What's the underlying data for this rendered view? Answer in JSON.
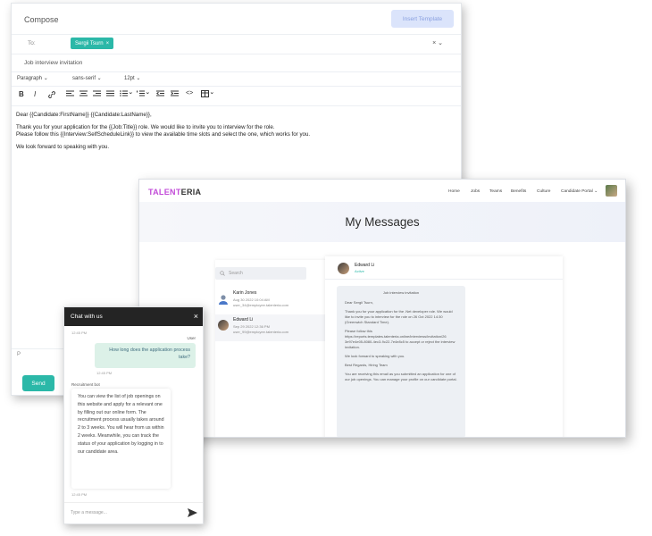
{
  "compose": {
    "title": "Compose",
    "insert_template": "Insert Template",
    "to_label": "To:",
    "recipient": "Sergii Tsurn",
    "chip_close": "×",
    "to_controls": "× ⌄",
    "subject": "Job interview invitation",
    "format": {
      "block": "Paragraph",
      "font": "sans-serif",
      "size": "12pt"
    },
    "toolbar": {
      "bold": "B",
      "italic": "I"
    },
    "body": [
      "Dear {{Candidate:FirstName}} {{Candidate:LastName}},",
      "Thank you for your application for the {{Job:Title}} role. We would like to invite you to interview for the role.",
      "Please follow this {{Interview:SelfScheduleLink}} to view the available time slots and select the one, which works for you.",
      "We look forward to speaking with you."
    ],
    "p_mark": "P",
    "send": "Send"
  },
  "portal": {
    "logo_a": "TALENT",
    "logo_b": "ERIA",
    "nav": [
      "Home",
      "Jobs",
      "Teams",
      "Benefits",
      "Culture",
      "Candidate Portal ⌄"
    ],
    "page_title": "My Messages",
    "search_placeholder": "Search",
    "contacts": [
      {
        "name": "Karin Jones",
        "date": "Aug 30 2022 10:04 AM",
        "email": "user_34@employee.talenteria.com"
      },
      {
        "name": "Edward Li",
        "date": "Sep 29 2022 12:36 PM",
        "email": "user_99@employee.talenteria.com"
      }
    ],
    "thread": {
      "name": "Edward Li",
      "status": "Active",
      "subject": "Job interview invitation",
      "lines": [
        "Dear Sergii Tsurn,",
        "Thank you for your application for the .Net developer role. We would like to invite you to interview for the role on 26 Oct 2022 14:30 (Greenwich Standard Time).",
        "Please follow this https://reports.templates.talenteria.online/interviews/invitation/26 3e97e4e05-8080-4ec3-9c22-7e4e8c5 to accept or reject the interview invitation.",
        "We look forward to speaking with you.",
        "Best Regards, Hiring Team",
        "You are receiving this email as you submitted an application for one of our job openings. You can manage your profile on our candidate portal."
      ]
    }
  },
  "chat": {
    "title": "Chat with us",
    "close": "×",
    "time1": "12:45 PM",
    "user_label": "User",
    "user_message": "How long does the application process take?",
    "time2": "12:45 PM",
    "bot_label": "Recruitment bot",
    "bot_message": "You can view the list of job openings on this website and apply for a relevant one by filling out our online form. The recruitment process usually takes around 2 to 3 weeks. You will hear from us within 2 weeks. Meanwhile, you can track the status of your application by logging in to our candidate area.",
    "time3": "12:45 PM",
    "input_placeholder": "Type a message..."
  }
}
